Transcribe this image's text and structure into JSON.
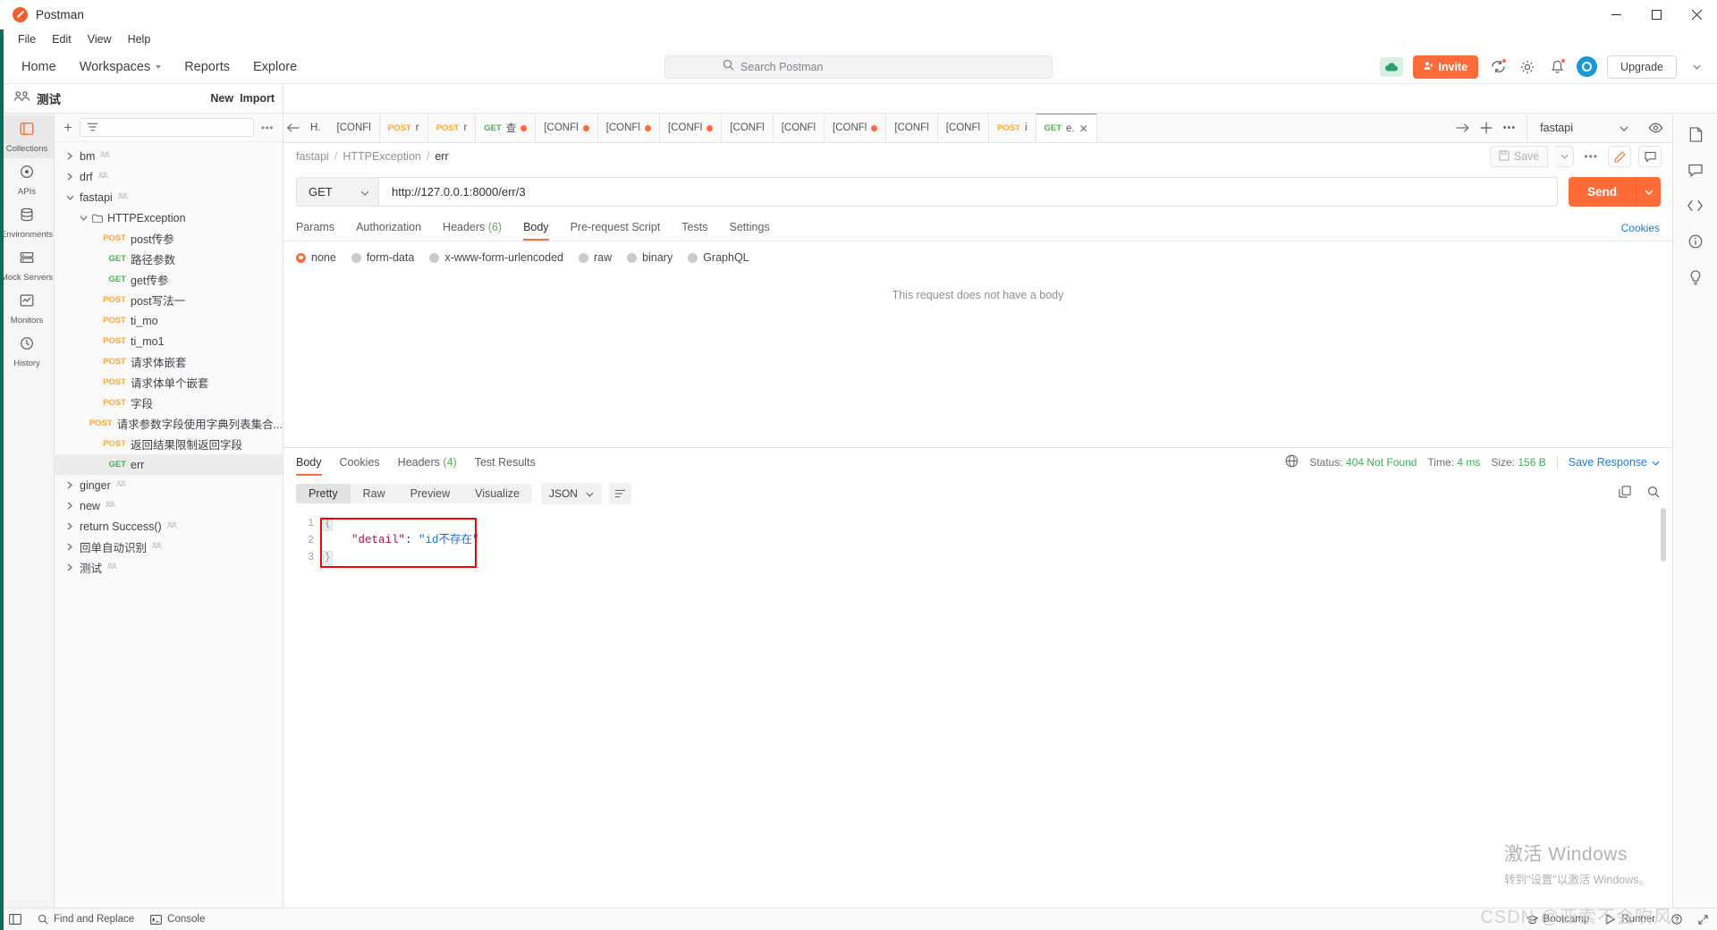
{
  "window": {
    "title": "Postman",
    "minimize_label": "Minimize",
    "maximize_label": "Maximize",
    "close_label": "Close"
  },
  "menubar": {
    "items": [
      "File",
      "Edit",
      "View",
      "Help"
    ]
  },
  "navbar": {
    "links": [
      "Home",
      "Workspaces",
      "Reports",
      "Explore"
    ],
    "search_placeholder": "Search Postman",
    "invite_label": "Invite",
    "upgrade_label": "Upgrade"
  },
  "workspace": {
    "name": "测试",
    "new_label": "New",
    "import_label": "Import"
  },
  "rail": {
    "items": [
      {
        "label": "Collections",
        "icon": "collections-icon",
        "active": true
      },
      {
        "label": "APIs",
        "icon": "apis-icon",
        "active": false
      },
      {
        "label": "Environments",
        "icon": "environments-icon",
        "active": false
      },
      {
        "label": "Mock Servers",
        "icon": "mock-servers-icon",
        "active": false
      },
      {
        "label": "Monitors",
        "icon": "monitors-icon",
        "active": false
      },
      {
        "label": "History",
        "icon": "history-icon",
        "active": false
      }
    ]
  },
  "sidebar": {
    "filter_placeholder": "",
    "tree": [
      {
        "type": "collection",
        "name": "bm",
        "expanded": false,
        "shared": true,
        "indent": 0
      },
      {
        "type": "collection",
        "name": "drf",
        "expanded": false,
        "shared": true,
        "indent": 0
      },
      {
        "type": "collection",
        "name": "fastapi",
        "expanded": true,
        "shared": true,
        "indent": 0
      },
      {
        "type": "folder",
        "name": "HTTPException",
        "expanded": true,
        "indent": 1
      },
      {
        "type": "request",
        "method": "POST",
        "name": "post传参",
        "indent": 2
      },
      {
        "type": "request",
        "method": "GET",
        "name": "路径参数",
        "indent": 2
      },
      {
        "type": "request",
        "method": "GET",
        "name": "get传参",
        "indent": 2
      },
      {
        "type": "request",
        "method": "POST",
        "name": "post写法一",
        "indent": 2
      },
      {
        "type": "request",
        "method": "POST",
        "name": "ti_mo",
        "indent": 2
      },
      {
        "type": "request",
        "method": "POST",
        "name": "ti_mo1",
        "indent": 2
      },
      {
        "type": "request",
        "method": "POST",
        "name": "请求体嵌套",
        "indent": 2
      },
      {
        "type": "request",
        "method": "POST",
        "name": "请求体单个嵌套",
        "indent": 2
      },
      {
        "type": "request",
        "method": "POST",
        "name": "字段",
        "indent": 2
      },
      {
        "type": "request",
        "method": "POST",
        "name": "请求参数字段使用字典列表集合...",
        "indent": 2
      },
      {
        "type": "request",
        "method": "POST",
        "name": "返回结果限制返回字段",
        "indent": 2
      },
      {
        "type": "request",
        "method": "GET",
        "name": "err",
        "indent": 2,
        "selected": true
      },
      {
        "type": "collection",
        "name": "ginger",
        "expanded": false,
        "shared": true,
        "indent": 0
      },
      {
        "type": "collection",
        "name": "new",
        "expanded": false,
        "shared": true,
        "indent": 0
      },
      {
        "type": "collection",
        "name": "return Success()",
        "expanded": false,
        "shared": true,
        "indent": 0
      },
      {
        "type": "collection",
        "name": "回单自动识别",
        "expanded": false,
        "shared": true,
        "indent": 0
      },
      {
        "type": "collection",
        "name": "测试",
        "expanded": false,
        "shared": true,
        "indent": 0
      }
    ]
  },
  "tabstrip": {
    "tabs": [
      {
        "method": "",
        "label": "H.",
        "dirty": false,
        "active": false,
        "back": true
      },
      {
        "method": "",
        "label": "[CONFl",
        "dirty": false,
        "active": false
      },
      {
        "method": "POST",
        "label": "r",
        "dirty": false,
        "active": false
      },
      {
        "method": "POST",
        "label": "r",
        "dirty": false,
        "active": false
      },
      {
        "method": "GET",
        "label": "查",
        "dirty": true,
        "active": false
      },
      {
        "method": "",
        "label": "[CONFl",
        "dirty": true,
        "active": false
      },
      {
        "method": "",
        "label": "[CONFl",
        "dirty": true,
        "active": false
      },
      {
        "method": "",
        "label": "[CONFl",
        "dirty": true,
        "active": false
      },
      {
        "method": "",
        "label": "[CONFl",
        "dirty": false,
        "active": false
      },
      {
        "method": "",
        "label": "[CONFl",
        "dirty": false,
        "active": false
      },
      {
        "method": "",
        "label": "[CONFl",
        "dirty": true,
        "active": false
      },
      {
        "method": "",
        "label": "[CONFl",
        "dirty": false,
        "active": false
      },
      {
        "method": "",
        "label": "[CONFl",
        "dirty": false,
        "active": false
      },
      {
        "method": "POST",
        "label": "i",
        "dirty": false,
        "active": false
      },
      {
        "method": "GET",
        "label": "e.",
        "dirty": false,
        "active": true,
        "closable": true
      }
    ],
    "environment": "fastapi"
  },
  "breadcrumb": {
    "collection": "fastapi",
    "folder": "HTTPException",
    "request": "err",
    "sep": "/",
    "save_label": "Save"
  },
  "request": {
    "method": "GET",
    "url": "http://127.0.0.1:8000/err/3",
    "send_label": "Send",
    "tabs": [
      {
        "label": "Params",
        "count": "",
        "active": false
      },
      {
        "label": "Authorization",
        "count": "",
        "active": false
      },
      {
        "label": "Headers",
        "count": "(6)",
        "active": false
      },
      {
        "label": "Body",
        "count": "",
        "active": true
      },
      {
        "label": "Pre-request Script",
        "count": "",
        "active": false
      },
      {
        "label": "Tests",
        "count": "",
        "active": false
      },
      {
        "label": "Settings",
        "count": "",
        "active": false
      }
    ],
    "cookies_link": "Cookies",
    "body_types": [
      {
        "label": "none",
        "selected": true
      },
      {
        "label": "form-data",
        "selected": false
      },
      {
        "label": "x-www-form-urlencoded",
        "selected": false
      },
      {
        "label": "raw",
        "selected": false
      },
      {
        "label": "binary",
        "selected": false
      },
      {
        "label": "GraphQL",
        "selected": false
      }
    ],
    "empty_body_message": "This request does not have a body"
  },
  "response": {
    "tabs": [
      {
        "label": "Body",
        "count": "",
        "active": true
      },
      {
        "label": "Cookies",
        "count": "",
        "active": false
      },
      {
        "label": "Headers",
        "count": "(4)",
        "active": false
      },
      {
        "label": "Test Results",
        "count": "",
        "active": false
      }
    ],
    "status_label": "Status:",
    "status_value": "404 Not Found",
    "time_label": "Time:",
    "time_value": "4 ms",
    "size_label": "Size:",
    "size_value": "156 B",
    "save_response_label": "Save Response",
    "view_tabs": [
      {
        "label": "Pretty",
        "active": true
      },
      {
        "label": "Raw",
        "active": false
      },
      {
        "label": "Preview",
        "active": false
      },
      {
        "label": "Visualize",
        "active": false
      }
    ],
    "format": "JSON",
    "body_lines": [
      {
        "num": "1",
        "fold": "{",
        "text": ""
      },
      {
        "num": "2",
        "fold": "",
        "key": "\"detail\"",
        "colon": ": ",
        "value": "\"id不存在\""
      },
      {
        "num": "3",
        "fold": "}",
        "text": ""
      }
    ],
    "annotation_color": "#ff0000"
  },
  "statusbar": {
    "find_replace": "Find and Replace",
    "console": "Console",
    "bootcamp": "Bootcamp",
    "runner": "Runner"
  },
  "watermark": {
    "line1": "激活 Windows",
    "line2": "转到\"设置\"以激活 Windows。",
    "csdn": "CSDN @亚索不会吹风"
  },
  "colors": {
    "accent": "#ff6c37",
    "get": "#4caf50",
    "post": "#ffa733",
    "link": "#1d7dd6",
    "status_ok": "#3cae5b",
    "annotation": "#ff0000"
  }
}
